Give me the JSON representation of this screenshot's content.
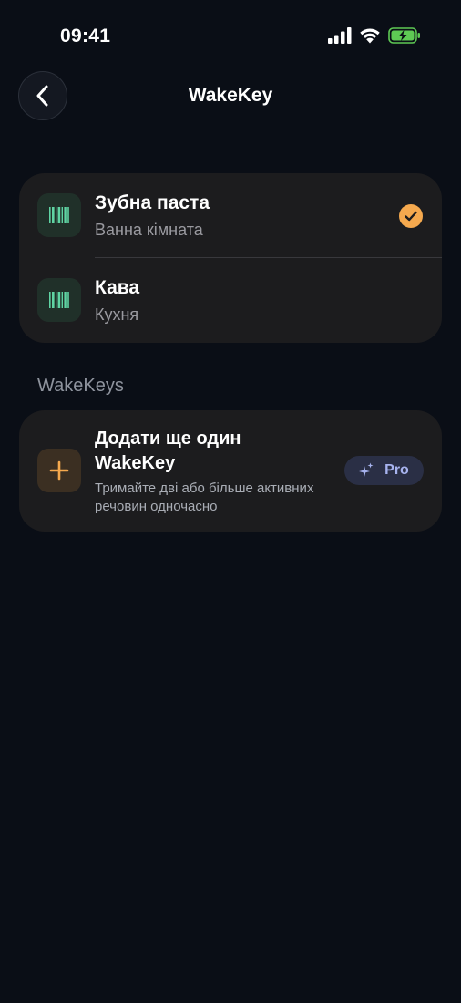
{
  "status_bar": {
    "time": "09:41"
  },
  "nav": {
    "title": "WakeKey"
  },
  "keys": [
    {
      "title": "Зубна паста",
      "subtitle": "Ванна кімната",
      "selected": true
    },
    {
      "title": "Кава",
      "subtitle": "Кухня",
      "selected": false
    }
  ],
  "section": {
    "title": "WakeKeys"
  },
  "add_card": {
    "title": "Додати ще один WakeKey",
    "description": "Тримайте дві або більше активних речовин одночасно",
    "badge_label": "Pro"
  },
  "colors": {
    "background": "#0a0e16",
    "card": "#1c1c1e",
    "accent_orange": "#f5a94e",
    "barcode_green": "#5fd3a3",
    "pro_text": "#a7b3ee"
  },
  "icons": {
    "back": "chevron-left-icon",
    "key": "barcode-icon",
    "selected": "checkmark-icon",
    "add": "plus-icon",
    "pro": "sparkles-icon"
  }
}
